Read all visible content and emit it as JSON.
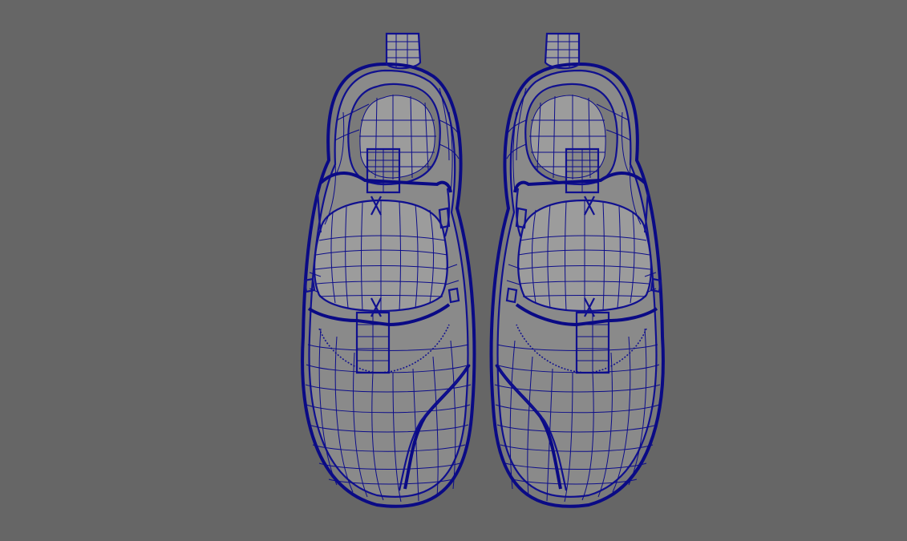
{
  "viewport": {
    "background": "#666666",
    "wireframe_color": "#0c0c8a",
    "shading_color": "#8a8a8a"
  },
  "objects": [
    {
      "id": "left-shoe",
      "side": "left"
    },
    {
      "id": "right-shoe",
      "side": "right"
    }
  ]
}
